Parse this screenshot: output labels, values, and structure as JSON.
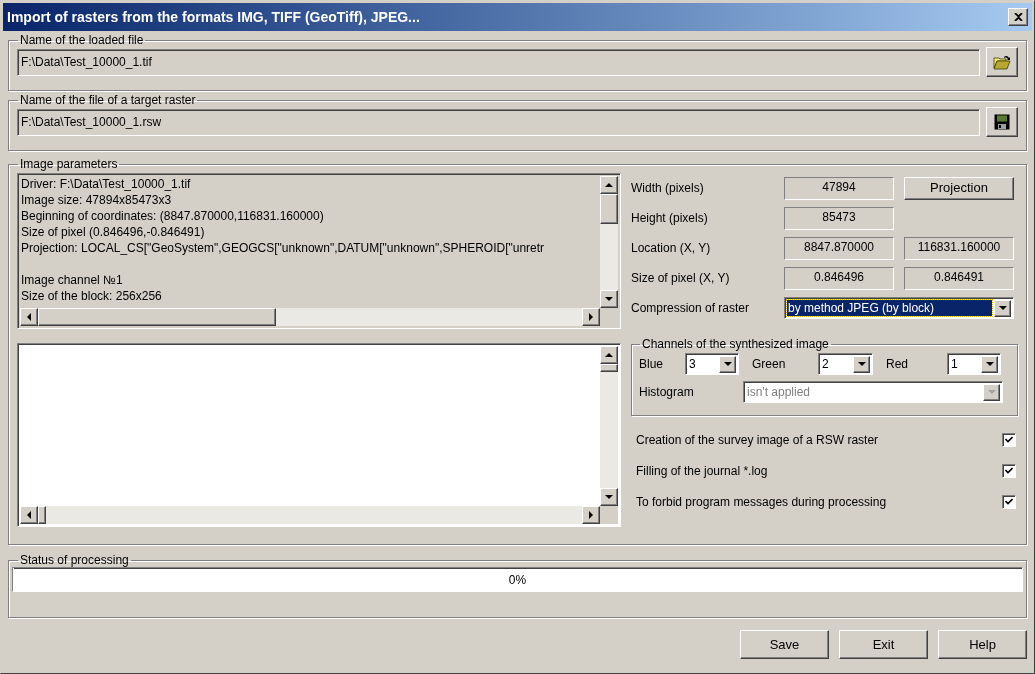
{
  "window": {
    "title": "Import of rasters from the formats IMG, TIFF (GeoTiff), JPEG..."
  },
  "loaded_file": {
    "label": "Name of the loaded file",
    "value": "F:\\Data\\Test_10000_1.tif",
    "kind": "open"
  },
  "target_file": {
    "label": "Name of the file of a target raster",
    "value": "F:\\Data\\Test_10000_1.rsw",
    "kind": "save"
  },
  "image_parameters": {
    "label": "Image parameters",
    "info": [
      [
        "Driver: F:\\Data\\Test_10000_1.tif",
        "Image size: 47894x85473x3",
        "Beginning of coordinates: (8847.870000,116831.160000)",
        "Size of pixel (0.846496,-0.846491)",
        "Projection: LOCAL_CS[\"GeoSystem\",GEOGCS[\"unknown\",DATUM[\"unknown\",SPHEROID[\"unretr"
      ],
      [
        "Image channel №1",
        "Size of the block: 256x256"
      ]
    ],
    "properties": [
      {
        "label": "Width (pixels)",
        "values": [
          "47894"
        ]
      },
      {
        "label": "Height (pixels)",
        "values": [
          "85473"
        ]
      },
      {
        "label": "Location (X, Y)",
        "values": [
          "8847.870000",
          "116831.160000"
        ]
      },
      {
        "label": "Size of pixel (X, Y)",
        "values": [
          "0.846496",
          "0.846491"
        ]
      }
    ],
    "projection_button": "Projection",
    "compression": {
      "label": "Compression of raster",
      "value": "by method JPEG (by block)",
      "focused": true
    },
    "channels": {
      "label": "Channels of the synthesized image",
      "items": [
        {
          "label": "Blue",
          "value": "3"
        },
        {
          "label": "Green",
          "value": "2"
        },
        {
          "label": "Red",
          "value": "1"
        }
      ],
      "histogram": {
        "label": "Histogram",
        "value": "isn't applied",
        "disabled": true
      }
    },
    "options": [
      {
        "label": "Creation of the survey image of a RSW raster",
        "checked": true
      },
      {
        "label": "Filling of the journal *.log",
        "checked": true
      },
      {
        "label": "To forbid program messages during processing",
        "checked": true
      }
    ]
  },
  "status": {
    "label": "Status of processing",
    "level": 0,
    "reading": "0%"
  },
  "buttons": [
    "Save",
    "Exit",
    "Help"
  ]
}
